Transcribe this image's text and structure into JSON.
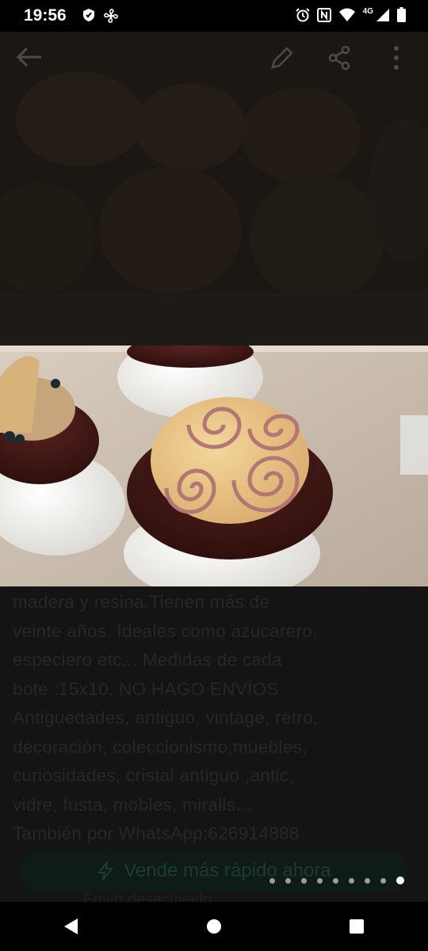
{
  "status_bar": {
    "time": "19:56",
    "network": "4G",
    "icons": [
      "shield-icon",
      "fan-icon",
      "alarm-icon",
      "nfc-icon",
      "wifi-icon",
      "signal-icon",
      "battery-icon"
    ]
  },
  "toolbar": {
    "icons": [
      "back-arrow-icon",
      "edit-icon",
      "share-icon",
      "more-icon"
    ]
  },
  "description": {
    "lines": [
      "madera y resina.Tienen más de",
      "veinte años. Ideales como azucarero,",
      "especiero etc... Medidas de cada",
      "bote :15x10. NO HAGO ENVÍOS",
      "Antiguedades, antiguo, vintage, retro,",
      "decoración, coleccionismo,muebles,",
      "curiosidades, cristal antiguo ,antic,",
      "vidre, fusta, mobles, miralls...",
      "También por WhatsApp:626914888"
    ]
  },
  "cta": {
    "label": "Vende más rápido ahora",
    "sub_label": "Envío desactivado"
  },
  "gallery": {
    "total": 9,
    "current": 9
  },
  "colors": {
    "cta_bg": "#0f1b18",
    "active_dot": "#ffffff",
    "inactive_dot": "#9c9c9c"
  },
  "nav_bar": {
    "buttons": [
      "back-triangle-icon",
      "home-circle-icon",
      "recents-square-icon"
    ]
  }
}
